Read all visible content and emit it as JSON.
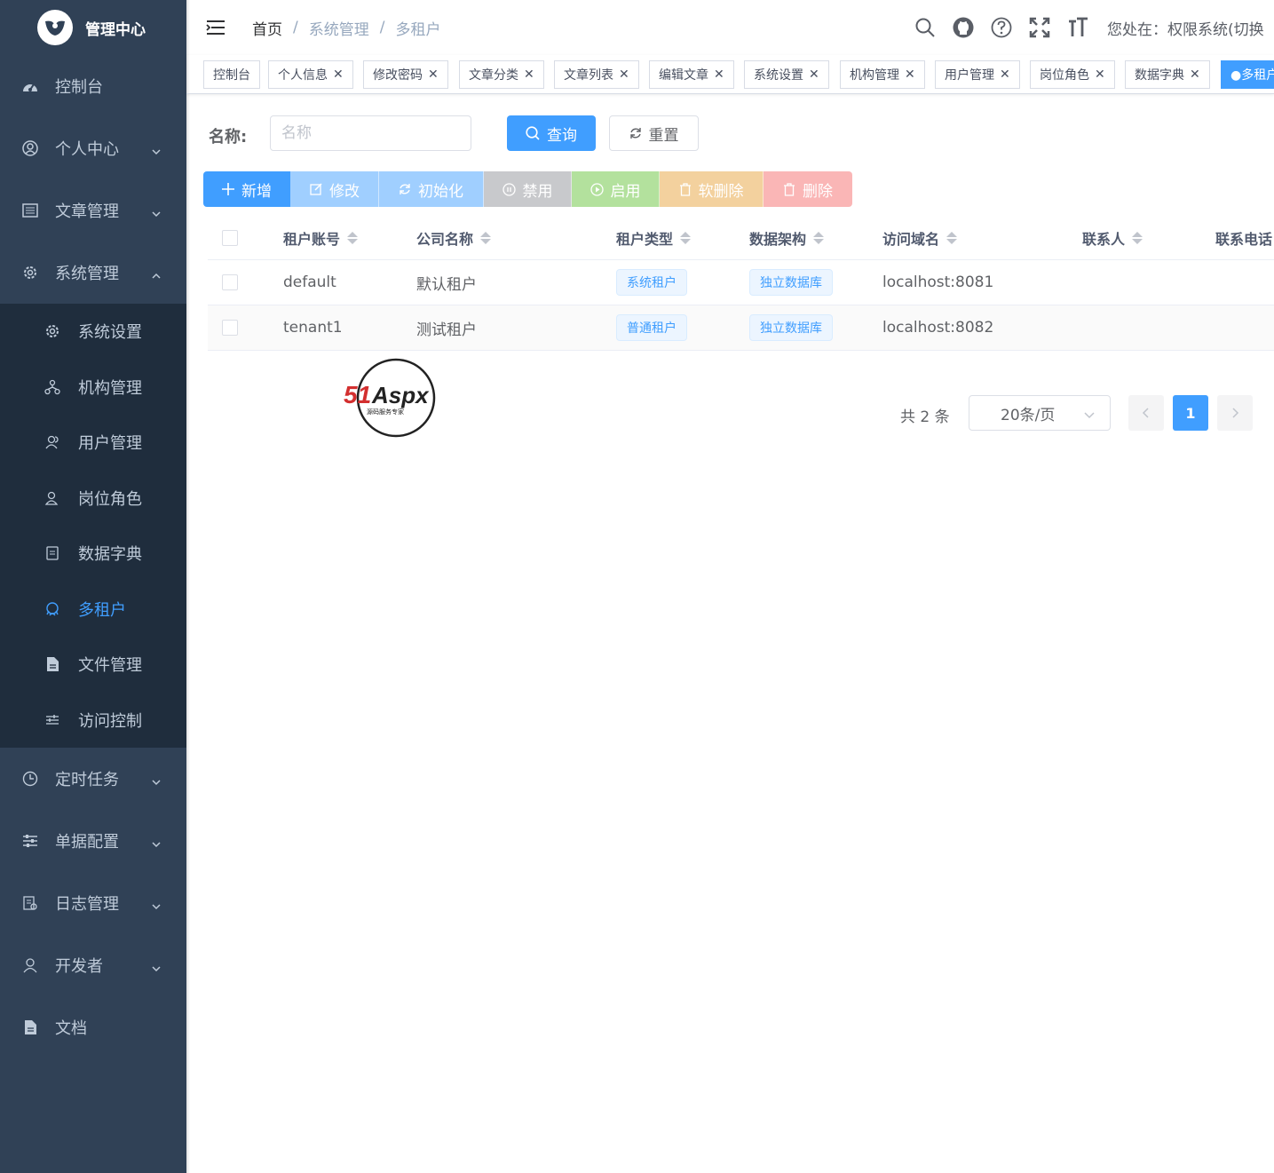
{
  "brand": {
    "title": "管理中心"
  },
  "sidebar": {
    "items": [
      {
        "label": "控制台",
        "icon": "dashboard-icon",
        "has_arrow": false
      },
      {
        "label": "个人中心",
        "icon": "user-circle-icon",
        "has_arrow": true,
        "arrow": "down"
      },
      {
        "label": "文章管理",
        "icon": "article-icon",
        "has_arrow": true,
        "arrow": "down"
      },
      {
        "label": "系统管理",
        "icon": "gear-icon",
        "has_arrow": true,
        "arrow": "up",
        "expanded": true
      }
    ],
    "submenu": [
      {
        "label": "系统设置",
        "icon": "gear-icon"
      },
      {
        "label": "机构管理",
        "icon": "org-tree-icon"
      },
      {
        "label": "用户管理",
        "icon": "users-icon"
      },
      {
        "label": "岗位角色",
        "icon": "role-icon"
      },
      {
        "label": "数据字典",
        "icon": "dictionary-icon"
      },
      {
        "label": "多租户",
        "icon": "tenant-icon",
        "active": true
      },
      {
        "label": "文件管理",
        "icon": "file-icon"
      },
      {
        "label": "访问控制",
        "icon": "sliders-icon"
      }
    ],
    "items_after": [
      {
        "label": "定时任务",
        "icon": "clock-icon",
        "has_arrow": true
      },
      {
        "label": "单据配置",
        "icon": "list-config-icon",
        "has_arrow": true
      },
      {
        "label": "日志管理",
        "icon": "log-icon",
        "has_arrow": true
      },
      {
        "label": "开发者",
        "icon": "developer-icon",
        "has_arrow": true
      },
      {
        "label": "文档",
        "icon": "document-icon",
        "has_arrow": false
      }
    ]
  },
  "header": {
    "breadcrumb": {
      "home": "首页",
      "sep": "/",
      "level1": "系统管理",
      "level2": "多租户"
    },
    "location": "您处在：权限系统(切换"
  },
  "tags": [
    "控制台",
    "个人信息",
    "修改密码",
    "文章分类",
    "文章列表",
    "编辑文章",
    "系统设置",
    "机构管理",
    "用户管理",
    "岗位角色",
    "数据字典",
    "●多租户"
  ],
  "search": {
    "label": "名称:",
    "placeholder": "名称",
    "query_label": "查询",
    "reset_label": "重置"
  },
  "toolbar": {
    "add": "新增",
    "edit": "修改",
    "init": "初始化",
    "disable": "禁用",
    "enable": "启用",
    "soft_delete": "软删除",
    "delete": "删除"
  },
  "table": {
    "columns": [
      "租户账号",
      "公司名称",
      "租户类型",
      "数据架构",
      "访问域名",
      "联系人",
      "联系电话"
    ],
    "rows": [
      {
        "account": "default",
        "company": "默认租户",
        "type": "系统租户",
        "arch": "独立数据库",
        "domain": "localhost:8081",
        "contact": "",
        "phone": ""
      },
      {
        "account": "tenant1",
        "company": "测试租户",
        "type": "普通租户",
        "arch": "独立数据库",
        "domain": "localhost:8082",
        "contact": "",
        "phone": ""
      }
    ]
  },
  "pagination": {
    "total": "共 2 条",
    "page_size": "20条/页",
    "current_page": "1"
  },
  "watermark": {
    "text": "51Aspx",
    "subtext": "源码服务专家"
  },
  "colors": {
    "sidebar_bg": "#304156",
    "submenu_bg": "#1f2d3d",
    "primary": "#409eff",
    "sidebar_text": "#bfcbd9"
  }
}
